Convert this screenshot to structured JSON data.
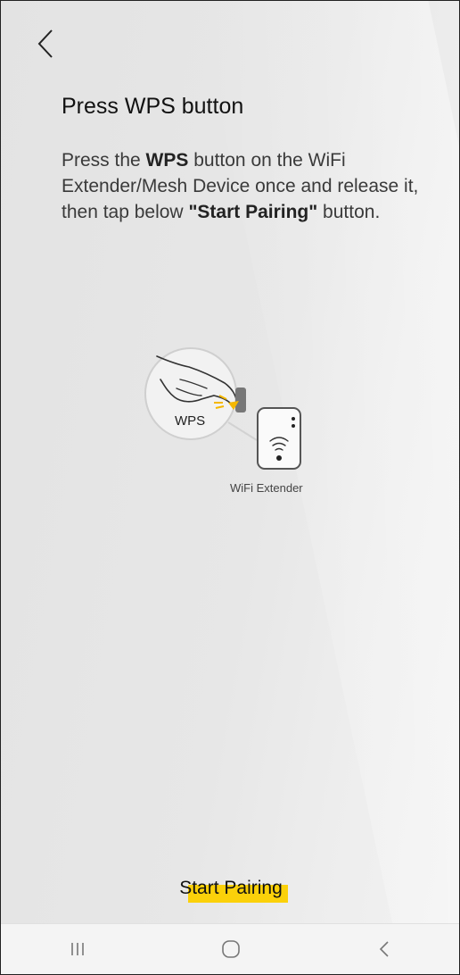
{
  "header": {
    "title": "Press WPS button"
  },
  "instructions": {
    "part1": "Press the ",
    "bold1": "WPS",
    "part2": " button on the WiFi Extender/Mesh Device once and release it, then tap below ",
    "bold2": "\"Start Pairing\"",
    "part3": " button."
  },
  "illustration": {
    "wps_label": "WPS",
    "device_label": "WiFi Extender"
  },
  "actions": {
    "start_pairing": "Start Pairing"
  },
  "colors": {
    "accent": "#fbd10a",
    "wps_led": "#f5b800"
  },
  "nav": {
    "recent_icon": "recent-apps-icon",
    "home_icon": "home-icon",
    "back_icon": "back-icon"
  }
}
